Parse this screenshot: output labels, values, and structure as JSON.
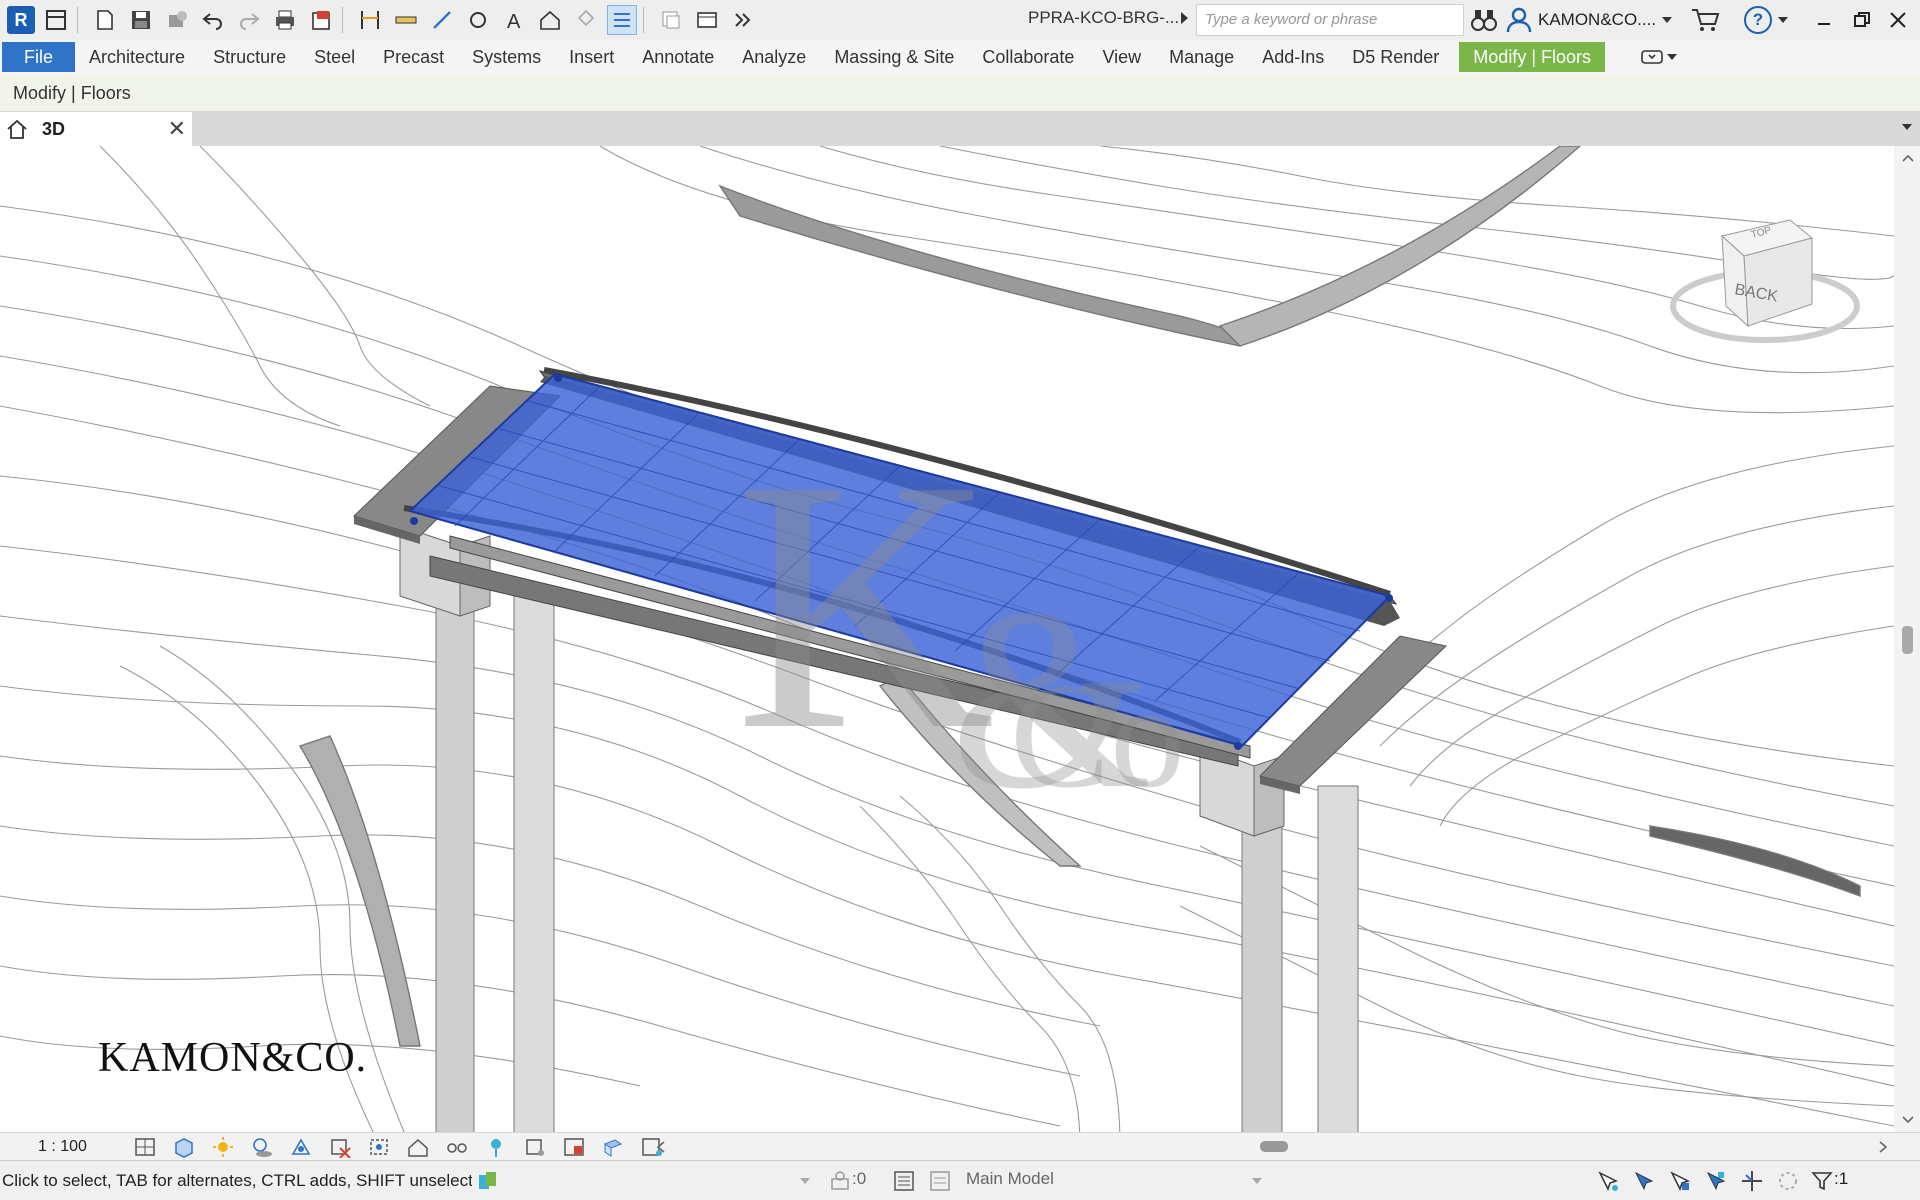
{
  "app": {
    "logo_letter": "R",
    "document_title": "PPRA-KCO-BRG-...",
    "search_placeholder": "Type a keyword or phrase",
    "user_name": "KAMON&CO...."
  },
  "ribbon": {
    "tabs": [
      {
        "label": "File"
      },
      {
        "label": "Architecture"
      },
      {
        "label": "Structure"
      },
      {
        "label": "Steel"
      },
      {
        "label": "Precast"
      },
      {
        "label": "Systems"
      },
      {
        "label": "Insert"
      },
      {
        "label": "Annotate"
      },
      {
        "label": "Analyze"
      },
      {
        "label": "Massing & Site"
      },
      {
        "label": "Collaborate"
      },
      {
        "label": "View"
      },
      {
        "label": "Manage"
      },
      {
        "label": "Add-Ins"
      },
      {
        "label": "D5 Render"
      },
      {
        "label": "Modify | Floors"
      }
    ],
    "context_label": "Modify | Floors"
  },
  "view_tab": {
    "label": "3D",
    "close": "✕"
  },
  "viewport": {
    "watermark_text": "KAMON&CO.",
    "viewcube_face": "BACK",
    "viewcube_top": "TOP"
  },
  "view_control": {
    "scale": "1 : 100"
  },
  "status": {
    "message": "Click to select, TAB for alternates, CTRL adds, SHIFT unselect",
    "worksets_count": ":0",
    "model": "Main Model",
    "filter_count": ":1"
  },
  "colors": {
    "file_tab": "#2e75c9",
    "modify_tab": "#7ab648",
    "selection_blue": "#3a63d6"
  }
}
